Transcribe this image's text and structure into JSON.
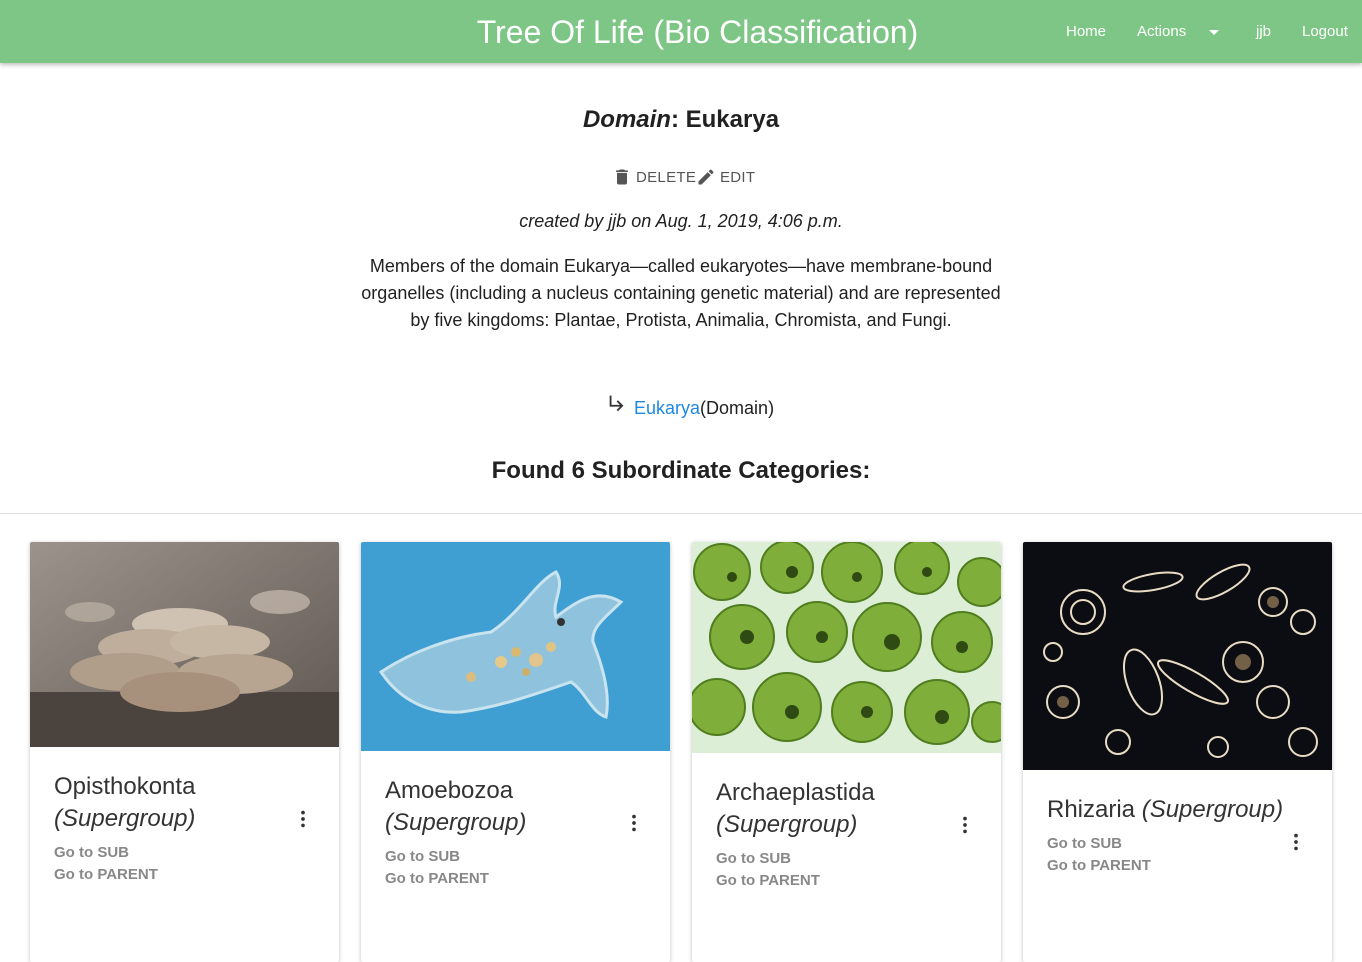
{
  "nav": {
    "brand": "Tree Of Life (Bio Classification)",
    "home": "Home",
    "actions": "Actions",
    "user": "jjb",
    "logout": "Logout",
    "color": "#7ec686"
  },
  "taxon": {
    "rank": "Domain",
    "sep": ":",
    "name": "Eukarya",
    "delete_label": "DELETE",
    "edit_label": "EDIT",
    "created": "created by jjb on Aug. 1, 2019, 4:06 p.m.",
    "description": "Members of the domain Eukarya—called eukaryotes—have membrane-bound organelles (including a nucleus containing genetic material) and are represented by five kingdoms: Plantae, Protista, Animalia, Chromista, and Fungi.",
    "lineage": {
      "icon": "subdirectory-arrow-icon",
      "link": "Eukarya",
      "rank": "(Domain)",
      "link_color": "#1e88e5"
    }
  },
  "subordinates": {
    "heading": "Found 6 Subordinate Categories:",
    "cards": [
      {
        "name": "Opisthokonta",
        "group": "(Supergroup)",
        "image": "oyster-mushrooms-photo",
        "sub_label": "Go to SUB",
        "parent_label": "Go to PARENT"
      },
      {
        "name": "Amoebozoa",
        "group": "(Supergroup)",
        "image": "amoeba-microscope-photo",
        "sub_label": "Go to SUB",
        "parent_label": "Go to PARENT"
      },
      {
        "name": "Archaeplastida",
        "group": "(Supergroup)",
        "image": "green-algae-cells-photo",
        "sub_label": "Go to SUB",
        "parent_label": "Go to PARENT"
      },
      {
        "name": "Rhizaria",
        "group": "(Supergroup)",
        "image": "foraminifera-shells-photo",
        "sub_label": "Go to SUB",
        "parent_label": "Go to PARENT"
      }
    ]
  }
}
